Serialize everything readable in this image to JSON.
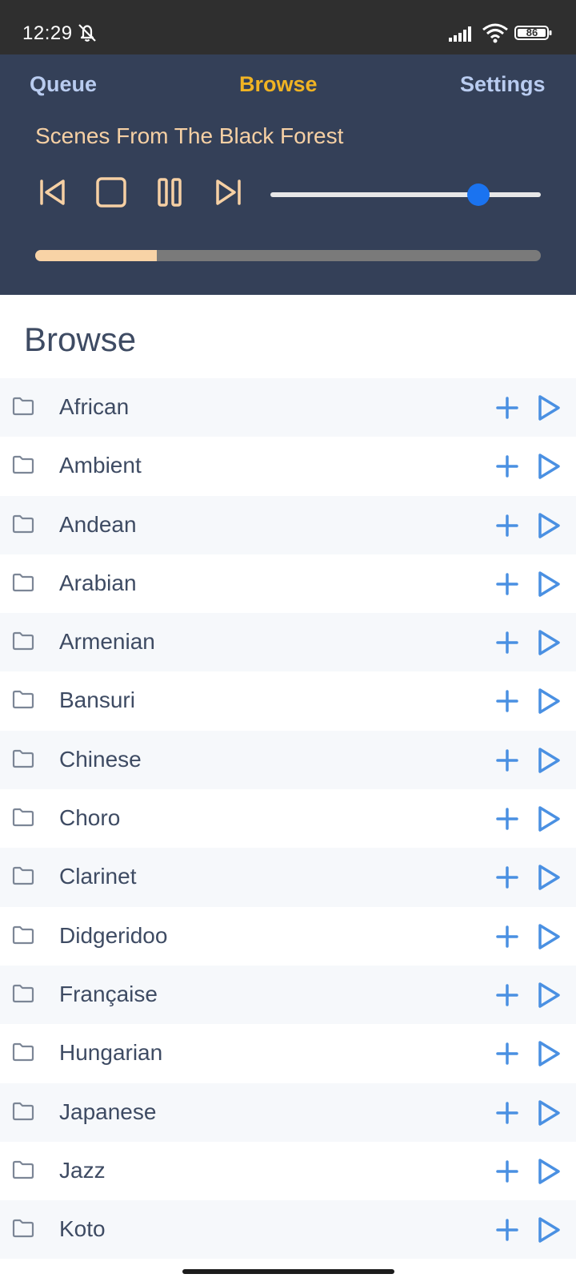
{
  "status_bar": {
    "time": "12:29",
    "battery": "86",
    "icons": [
      "mute-notifications-icon",
      "signal-icon",
      "wifi-icon",
      "battery-icon"
    ]
  },
  "nav": {
    "tabs": [
      {
        "label": "Queue",
        "active": false
      },
      {
        "label": "Browse",
        "active": true
      },
      {
        "label": "Settings",
        "active": false
      }
    ]
  },
  "player": {
    "track_title": "Scenes From The Black Forest",
    "controls": [
      "previous-icon",
      "stop-icon",
      "pause-icon",
      "next-icon"
    ],
    "volume_fraction": 0.77,
    "progress_fraction": 0.24,
    "colors": {
      "panel": "#344058",
      "accent": "#f6d0a4",
      "active_tab": "#f0b323",
      "slider": "#1a73f0"
    }
  },
  "browse": {
    "heading": "Browse",
    "items": [
      {
        "label": "African"
      },
      {
        "label": "Ambient"
      },
      {
        "label": "Andean"
      },
      {
        "label": "Arabian"
      },
      {
        "label": "Armenian"
      },
      {
        "label": "Bansuri"
      },
      {
        "label": "Chinese"
      },
      {
        "label": "Choro"
      },
      {
        "label": "Clarinet"
      },
      {
        "label": "Didgeridoo"
      },
      {
        "label": "Française"
      },
      {
        "label": "Hungarian"
      },
      {
        "label": "Japanese"
      },
      {
        "label": "Jazz"
      },
      {
        "label": "Koto"
      }
    ],
    "item_actions": [
      "add-icon",
      "play-icon"
    ],
    "colors": {
      "action": "#4a90e2",
      "folder": "#7c8696"
    }
  }
}
